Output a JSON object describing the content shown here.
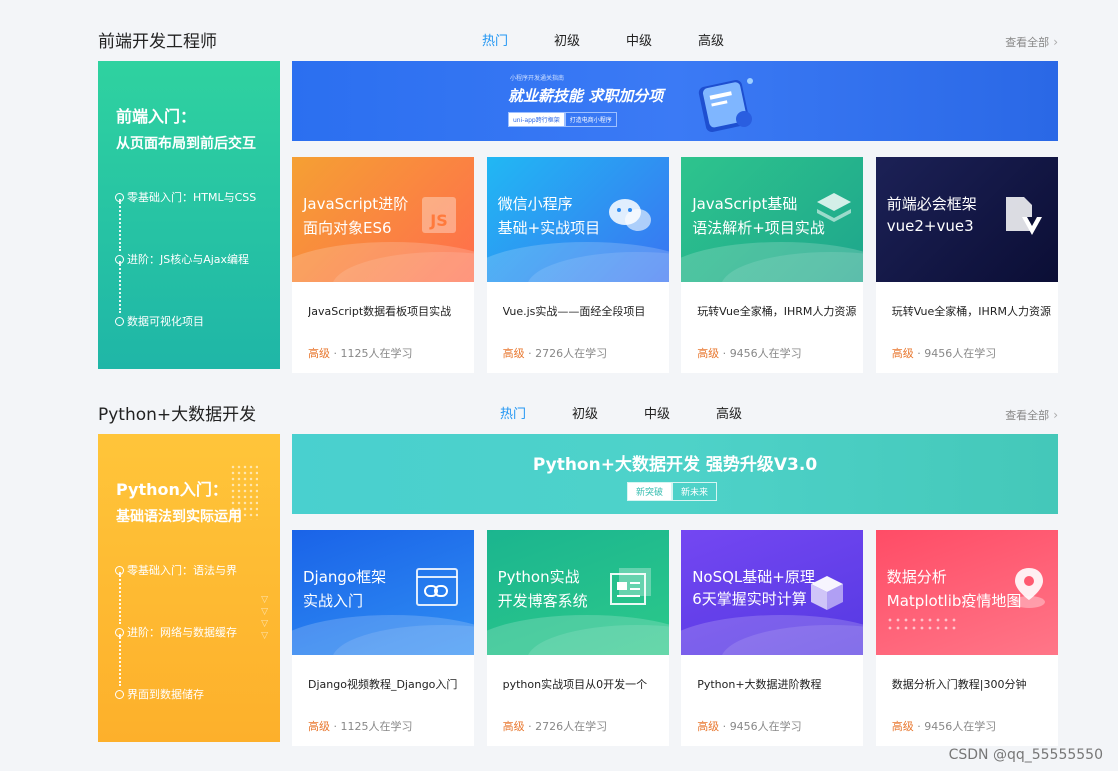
{
  "sections": [
    {
      "title": "前端开发工程师",
      "tabs": [
        "热门",
        "初级",
        "中级",
        "高级"
      ],
      "more": "查看全部",
      "side": {
        "title": "前端入门：",
        "subtitle": "从页面布局到前后交互",
        "steps": [
          "零基础入门：HTML与CSS",
          "进阶：JS核心与Ajax编程",
          "数据可视化项目"
        ]
      },
      "banner": {
        "small": "小程序开发通关指南",
        "main": "就业薪技能 求职加分项",
        "tags": [
          "uni-app跨行框架",
          "打造电商小程序"
        ]
      },
      "courses": [
        {
          "thumb_line1": "JavaScript进阶",
          "thumb_line2": "面向对象ES6",
          "title": "JavaScript数据看板项目实战",
          "level": "高级",
          "learners": "1125人在学习",
          "colors": [
            "#f58a33",
            "#ff6f4e"
          ],
          "icon": "js-icon"
        },
        {
          "thumb_line1": "微信小程序",
          "thumb_line2": "基础+实战项目",
          "title": "Vue.js实战——面经全段项目",
          "level": "高级",
          "learners": "2726人在学习",
          "colors": [
            "#1fa7f1",
            "#3b7cf4"
          ],
          "icon": "wechat-icon"
        },
        {
          "thumb_line1": "JavaScript基础",
          "thumb_line2": "语法解析+项目实战",
          "title": "玩转Vue全家桶，IHRM人力资源",
          "level": "高级",
          "learners": "9456人在学习",
          "colors": [
            "#2dbf8e",
            "#1fa68a"
          ],
          "icon": "layers-icon"
        },
        {
          "thumb_line1": "前端必会框架",
          "thumb_line2": "vue2+vue3",
          "title": "玩转Vue全家桶，IHRM人力资源",
          "level": "高级",
          "learners": "9456人在学习",
          "colors": [
            "#1a1f4f",
            "#0c1036"
          ],
          "icon": "vue-icon"
        }
      ]
    },
    {
      "title": "Python+大数据开发",
      "tabs": [
        "热门",
        "初级",
        "中级",
        "高级"
      ],
      "more": "查看全部",
      "side": {
        "title": "Python入门：",
        "subtitle": "基础语法到实际运用",
        "steps": [
          "零基础入门：语法与界",
          "进阶：网络与数据缓存",
          "界面到数据储存"
        ]
      },
      "banner": {
        "main": "Python+大数据开发 强势升级V3.0",
        "tags": [
          "新突破",
          "新未来"
        ]
      },
      "courses": [
        {
          "thumb_line1": "Django框架",
          "thumb_line2": "实战入门",
          "title": "Django视频教程_Django入门",
          "level": "高级",
          "learners": "1125人在学习",
          "colors": [
            "#1e6ff0",
            "#2f8cf5"
          ],
          "icon": "link-icon"
        },
        {
          "thumb_line1": "Python实战",
          "thumb_line2": "开发博客系统",
          "title": "python实战项目从0开发一个",
          "level": "高级",
          "learners": "2726人在学习",
          "colors": [
            "#1fbf8f",
            "#27c18a"
          ],
          "icon": "document-icon"
        },
        {
          "thumb_line1": "NoSQL基础+原理",
          "thumb_line2": "6天掌握实时计算",
          "title": "Python+大数据进阶教程",
          "level": "高级",
          "learners": "9456人在学习",
          "colors": [
            "#6b45f0",
            "#5a3ee6"
          ],
          "icon": "cube-icon"
        },
        {
          "thumb_line1": "数据分析",
          "thumb_line2": "Matplotlib疫情地图",
          "title": "数据分析入门教程|300分钟",
          "level": "高级",
          "learners": "9456人在学习",
          "colors": [
            "#ff4f6a",
            "#ff6c82"
          ],
          "icon": "map-pin-icon"
        }
      ]
    }
  ],
  "watermark": "CSDN @qq_55555550"
}
